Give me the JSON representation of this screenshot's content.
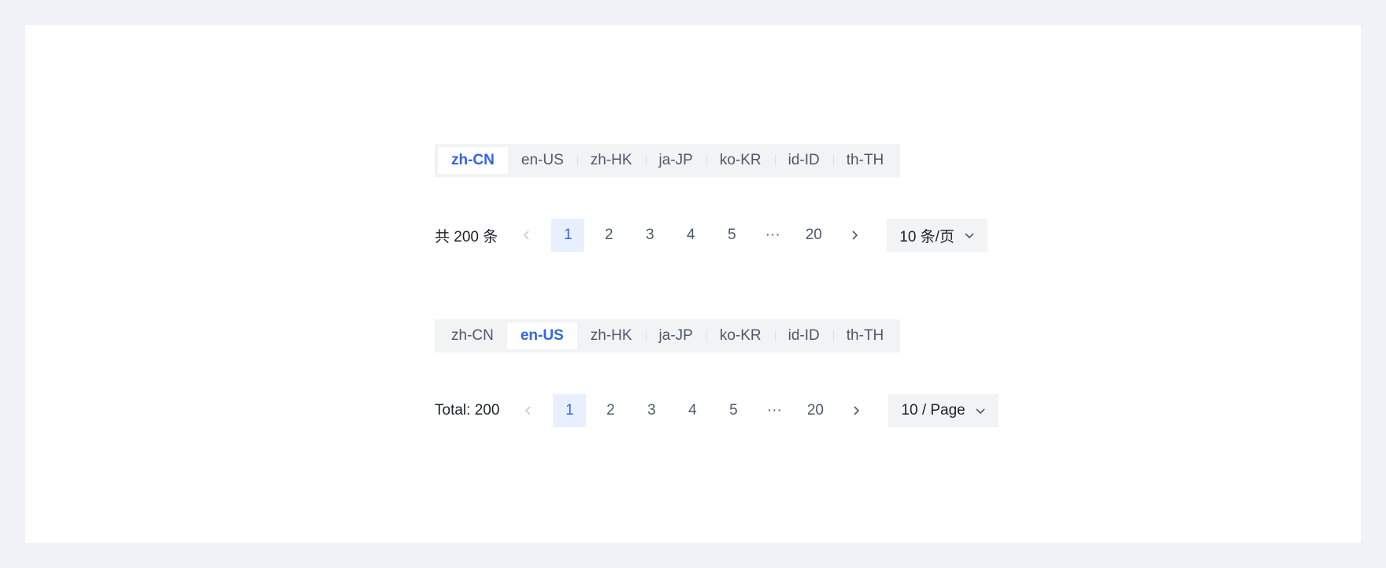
{
  "locales": [
    "zh-CN",
    "en-US",
    "zh-HK",
    "ja-JP",
    "ko-KR",
    "id-ID",
    "th-TH"
  ],
  "demo1": {
    "active_locale": "zh-CN",
    "total_label": "共 200 条",
    "pages": [
      "1",
      "2",
      "3",
      "4",
      "5",
      "···",
      "20"
    ],
    "current_page": "1",
    "page_size_label": "10 条/页"
  },
  "demo2": {
    "active_locale": "en-US",
    "total_label": "Total: 200",
    "pages": [
      "1",
      "2",
      "3",
      "4",
      "5",
      "···",
      "20"
    ],
    "current_page": "1",
    "page_size_label": "10 / Page"
  },
  "icons": {
    "prev": "chevron-left-icon",
    "next": "chevron-right-icon",
    "dropdown": "chevron-down-icon"
  },
  "colors": {
    "accent": "#3563e9",
    "active_page_bg": "#e8f0ff",
    "control_bg": "#f2f3f5",
    "page_bg": "#f0f2f7"
  }
}
